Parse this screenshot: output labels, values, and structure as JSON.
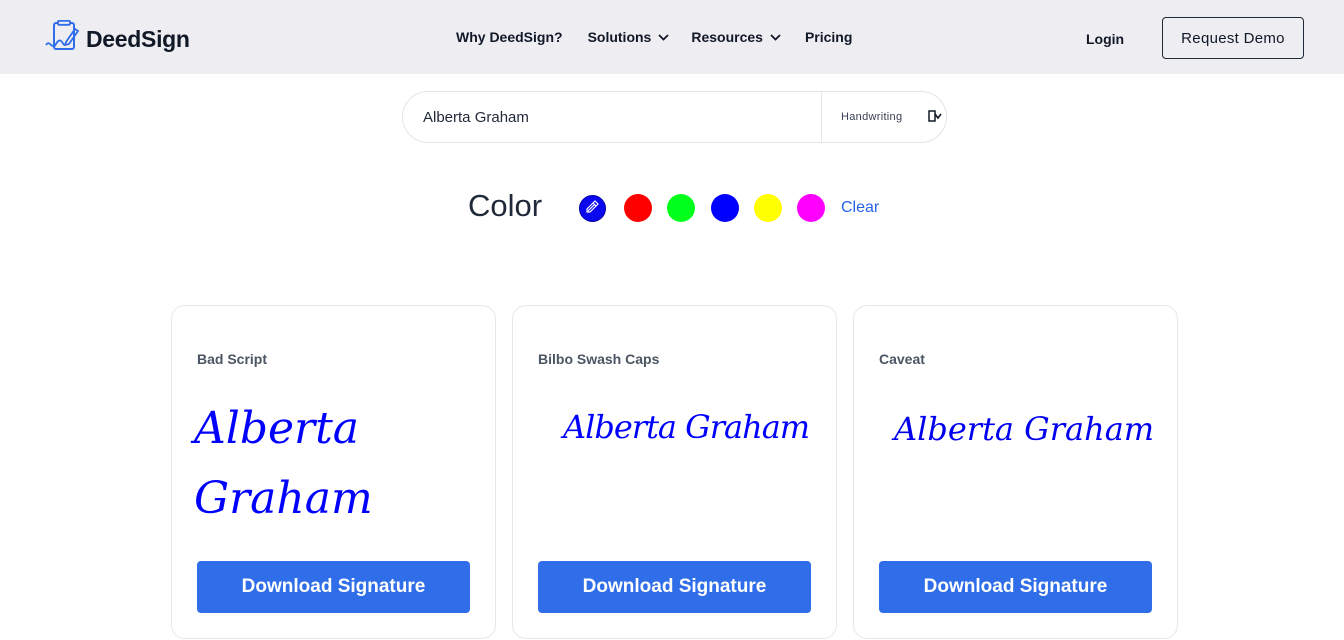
{
  "brand": {
    "name": "DeedSign",
    "icon": "signed-document-icon"
  },
  "nav": {
    "items": [
      {
        "label": "Why DeedSign?",
        "has_dropdown": false
      },
      {
        "label": "Solutions",
        "has_dropdown": true
      },
      {
        "label": "Resources",
        "has_dropdown": true
      },
      {
        "label": "Pricing",
        "has_dropdown": false
      }
    ],
    "login_label": "Login",
    "demo_label": "Request Demo"
  },
  "signature_form": {
    "name_value": "Alberta Graham",
    "font_select_label": "Handwriting"
  },
  "colors": {
    "label": "Color",
    "picker_icon": "eyedropper-icon",
    "swatches": [
      "#ff0000",
      "#00ff1a",
      "#0000ff",
      "#ffff00",
      "#ff00ff"
    ],
    "selected": "#0000ff",
    "clear_label": "Clear"
  },
  "cards": [
    {
      "font_name": "Bad Script",
      "signature_text": "Alberta Graham",
      "button_label": "Download Signature"
    },
    {
      "font_name": "Bilbo Swash Caps",
      "signature_text": "Alberta Graham",
      "button_label": "Download Signature"
    },
    {
      "font_name": "Caveat",
      "signature_text": "Alberta Graham",
      "button_label": "Download Signature"
    }
  ],
  "accent_color": "#2f6ee8"
}
